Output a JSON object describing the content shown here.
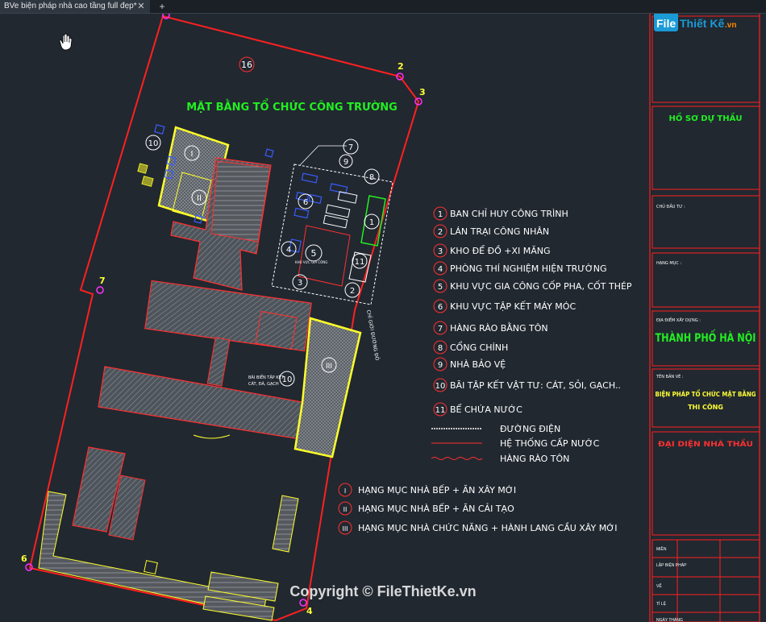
{
  "tab": {
    "title": "BVe biện pháp nhà cao tầng full đẹp*",
    "close": "✕",
    "new": "+"
  },
  "drawing": {
    "title": "MẶT BẰNG TỔ CHỨC CÔNG TRƯỜNG",
    "markers": {
      "m16": "16",
      "m2": "2",
      "m3": "3",
      "m7": "7",
      "m6": "6",
      "m4": "4"
    },
    "bubbles": {
      "b7": "7",
      "b9": "9",
      "b8": "8",
      "b6": "6",
      "b4": "4",
      "b5": "5",
      "b3": "3",
      "b2": "2",
      "b1": "1",
      "b11": "11",
      "b10a": "10",
      "b10b": "10"
    },
    "roman": {
      "r1": "I",
      "r2": "II",
      "r3": "III"
    },
    "small_text": {
      "area5": "KHU VỰC GIA CÔNG",
      "road": "CHỈ GIỚI ĐƯỜNG ĐỎ",
      "bai1": "BÃI BIỂN TẬP KẾT",
      "bai2": "CÁT, ĐÁ, GẠCH"
    }
  },
  "legend": {
    "items": [
      {
        "num": "1",
        "text": "BAN CHỈ HUY CÔNG TRÌNH"
      },
      {
        "num": "2",
        "text": "LÁN TRẠI CÔNG NHÂN"
      },
      {
        "num": "3",
        "text": "KHO ĐỂ ĐỒ +XI MĂNG"
      },
      {
        "num": "4",
        "text": "PHÒNG THÍ NGHIỆM HIỆN TRƯỜNG"
      },
      {
        "num": "5",
        "text": "KHU VỰC GIA CÔNG CỐP PHA, CỐT THÉP"
      },
      {
        "num": "6",
        "text": "KHU VỰC TẬP KẾT MÁY MÓC"
      },
      {
        "num": "7",
        "text": "HÀNG RÀO BẰNG TÔN"
      },
      {
        "num": "8",
        "text": "CỔNG CHÍNH"
      },
      {
        "num": "9",
        "text": "NHÀ BẢO VỆ"
      },
      {
        "num": "10",
        "text": "BÃI TẬP KẾT VẬT TƯ: CÁT, SỎI, GẠCH.."
      },
      {
        "num": "11",
        "text": "BỂ CHỨA NƯỚC"
      }
    ],
    "lines": [
      {
        "text": "ĐƯỜNG ĐIỆN"
      },
      {
        "text": "HỆ THỐNG CẤP NƯỚC"
      },
      {
        "text": "HÀNG RÀO TÔN"
      }
    ],
    "categories": [
      {
        "num": "I",
        "text": "HẠNG MỤC NHÀ BẾP + ĂN XÂY MỚI"
      },
      {
        "num": "II",
        "text": "HẠNG MỤC NHÀ BẾP + ĂN CẢI TẠO"
      },
      {
        "num": "III",
        "text": "HẠNG MỤC NHÀ CHỨC NĂNG + HÀNH LANG CẦU XÂY MỚI"
      }
    ]
  },
  "title_block": {
    "logo_a": "File",
    "logo_b": "Thiết Kế",
    "logo_c": ".vn",
    "ho_so": "HỒ SƠ DỰ THẦU",
    "chu_dau_tu": "CHỦ ĐẦU TƯ :",
    "hang_muc": "HẠNG MỤC :",
    "dia_diem": "ĐỊA ĐIỂM XÂY DỰNG :",
    "city": "THÀNH PHỐ HÀ NỘI",
    "ten_ban_ve": "TÊN BẢN VẼ :",
    "bien_phap_1": "BIỆN PHÁP TỔ CHỨC MẶT BẰNG",
    "bien_phap_2": "THI CÔNG",
    "dai_dien": "ĐẠI DIỆN NHÀ THẦU",
    "rows": [
      "MIỀN",
      "LẬP BIỆN PHÁP",
      "VẼ",
      "TỈ LỆ",
      "NGÀY THÁNG"
    ]
  },
  "watermark": "Copyright © FileThietKe.vn",
  "colors": {
    "background": "#212830",
    "boundary": "#ff1a1a",
    "building_outline": "#ffff2a",
    "title_green": "#00ff00",
    "legend_text": "#ffffff",
    "marker": "#ff00ff",
    "hatch": "#6e7378"
  }
}
